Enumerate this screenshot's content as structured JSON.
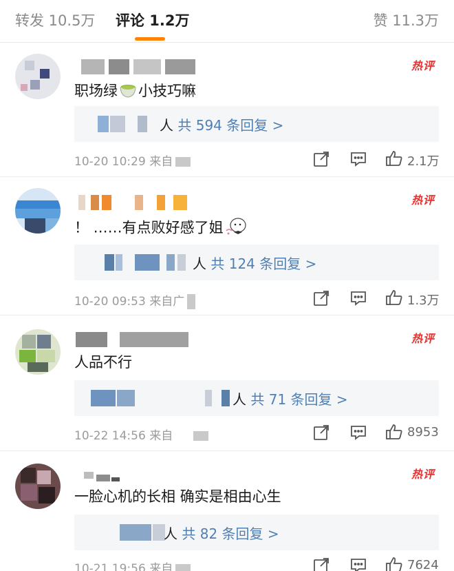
{
  "tabs": {
    "repost": "转发 10.5万",
    "comment": "评论 1.2万",
    "like": "赞 11.3万",
    "accent_color": "#ff8200"
  },
  "hot_badge": "热评",
  "comments": [
    {
      "text_before_emoji": "职场绿",
      "emoji": "tea-cup-emoji",
      "text_after_emoji": "小技巧嘛",
      "reply_person": "人",
      "reply_count": "共 594 条回复 >",
      "time": "10-20 10:29",
      "source_prefix": "来自",
      "likes": "2.1万"
    },
    {
      "text_before_emoji": "！ ……有点败好感了姐",
      "emoji": "sticker-emoji",
      "text_after_emoji": "",
      "reply_person": "人",
      "reply_count": "共 124 条回复 >",
      "time": "10-20 09:53",
      "source_prefix": "来自广",
      "likes": "1.3万"
    },
    {
      "text_before_emoji": "人品不行",
      "emoji": "",
      "text_after_emoji": "",
      "reply_person": "人",
      "reply_count": "共 71 条回复 >",
      "time": "10-22 14:56",
      "source_prefix": "来自",
      "likes": "8953"
    },
    {
      "text_before_emoji": "一脸心机的长相 确实是相由心生",
      "emoji": "",
      "text_after_emoji": "",
      "reply_person": "人",
      "reply_count": "共 82 条回复 >",
      "time": "10-21 19:56",
      "source_prefix": "来自",
      "likes": "7624"
    }
  ],
  "icons": {
    "share": "share-icon",
    "comment": "comment-icon",
    "like": "thumbs-up-icon"
  }
}
